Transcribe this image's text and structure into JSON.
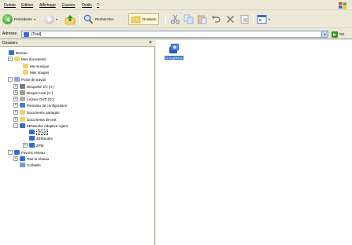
{
  "menu": {
    "items": [
      "Fichier",
      "Edition",
      "Affichage",
      "Favoris",
      "Outils",
      "?"
    ]
  },
  "toolbar": {
    "back_label": "Précédente",
    "search_label": "Rechercher",
    "folders_label": "Dossiers"
  },
  "address": {
    "label": "Adresse",
    "value": "[Tout]",
    "go_label": "OK"
  },
  "folders_panel": {
    "title": "Dossiers",
    "close": "×",
    "tree": [
      {
        "label": "Bureau",
        "icon": "desktop-icon",
        "expander": "",
        "color": "#3a6bc8"
      },
      {
        "label": "Mes documents",
        "icon": "folder-icon",
        "expander": "−",
        "color": "#f2d26b"
      },
      {
        "label": "Ma musique",
        "icon": "folder-icon",
        "expander": "",
        "color": "#f2d26b"
      },
      {
        "label": "Mes images",
        "icon": "folder-icon",
        "expander": "",
        "color": "#f2d26b"
      },
      {
        "label": "Poste de travail",
        "icon": "computer-icon",
        "expander": "−",
        "color": "#8aa6d8"
      },
      {
        "label": "Disquette 3½ (A:)",
        "icon": "floppy-icon",
        "expander": "+",
        "color": "#7a7a7a"
      },
      {
        "label": "Disque local (C:)",
        "icon": "drive-icon",
        "expander": "+",
        "color": "#9a9a9a"
      },
      {
        "label": "Lecteur DVD (D:)",
        "icon": "dvd-icon",
        "expander": "+",
        "color": "#b0b0b0"
      },
      {
        "label": "Panneau de configuration",
        "icon": "control-panel-icon",
        "expander": "+",
        "color": "#4d7cd1"
      },
      {
        "label": "Documents partagés",
        "icon": "folder-icon",
        "expander": "+",
        "color": "#f2d26b"
      },
      {
        "label": "Documents de test",
        "icon": "folder-icon",
        "expander": "+",
        "color": "#f2d26b"
      },
      {
        "label": "ZENworks Adaptive Agent",
        "icon": "network-icon",
        "expander": "−",
        "color": "#3a6bc8"
      },
      {
        "label": "[Tout]",
        "icon": "network-icon",
        "expander": "",
        "color": "#3a6bc8",
        "selected": true
      },
      {
        "label": "ZENworks",
        "icon": "network-icon",
        "expander": "",
        "color": "#3a6bc8"
      },
      {
        "label": "ZPM",
        "icon": "network-icon",
        "expander": "+",
        "color": "#3a6bc8"
      },
      {
        "label": "Favoris réseau",
        "icon": "network-places-icon",
        "expander": "−",
        "color": "#3a6bc8"
      },
      {
        "label": "Tout le réseau",
        "icon": "globe-icon",
        "expander": "+",
        "color": "#3a6bc8"
      },
      {
        "label": "Corbeille",
        "icon": "recycle-bin-icon",
        "expander": "",
        "color": "#6f9bd8"
      }
    ]
  },
  "content": {
    "items": [
      {
        "label": "GroupWise",
        "icon": "groupwise-icon"
      }
    ]
  },
  "colors": {
    "selection": "#316ac5",
    "chrome": "#ece9d8"
  }
}
